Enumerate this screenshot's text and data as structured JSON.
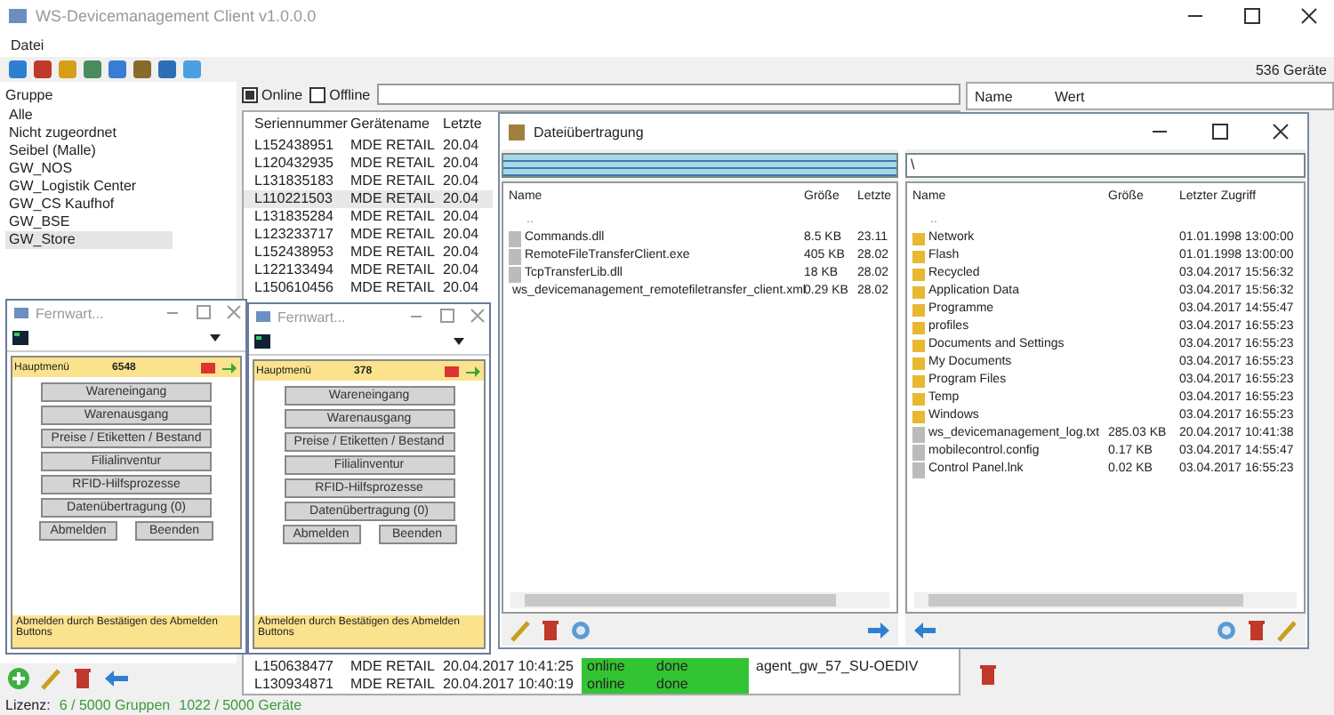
{
  "window": {
    "title": "WS-Devicemanagement Client v1.0.0.0"
  },
  "menu": [
    "Datei"
  ],
  "toolbar": {
    "device_count": "536 Geräte"
  },
  "groups": {
    "header": "Gruppe",
    "items": [
      {
        "label": "Alle",
        "selected": false
      },
      {
        "label": "Nicht zugeordnet",
        "selected": false
      },
      {
        "label": "Seibel (Malle)",
        "selected": false
      },
      {
        "label": "GW_NOS",
        "selected": false
      },
      {
        "label": "GW_Logistik Center",
        "selected": false
      },
      {
        "label": "GW_CS Kaufhof",
        "selected": false
      },
      {
        "label": "GW_BSE",
        "selected": false
      },
      {
        "label": "GW_Store",
        "selected": true
      }
    ]
  },
  "filter": {
    "online": {
      "label": "Online",
      "checked": true
    },
    "offline": {
      "label": "Offline",
      "checked": false
    }
  },
  "devices": {
    "columns": [
      "Seriennummer",
      "Gerätename",
      "Letzte"
    ],
    "rows": [
      {
        "serial": "L152438951",
        "name": "MDE RETAIL",
        "date": "20.04",
        "selected": false
      },
      {
        "serial": "L120432935",
        "name": "MDE RETAIL",
        "date": "20.04",
        "selected": false
      },
      {
        "serial": "L131835183",
        "name": "MDE RETAIL",
        "date": "20.04",
        "selected": false
      },
      {
        "serial": "L110221503",
        "name": "MDE RETAIL",
        "date": "20.04",
        "selected": true
      },
      {
        "serial": "L131835284",
        "name": "MDE RETAIL",
        "date": "20.04",
        "selected": false
      },
      {
        "serial": "L123233717",
        "name": "MDE RETAIL",
        "date": "20.04",
        "selected": false
      },
      {
        "serial": "L152438953",
        "name": "MDE RETAIL",
        "date": "20.04",
        "selected": false
      },
      {
        "serial": "L122133494",
        "name": "MDE RETAIL",
        "date": "20.04",
        "selected": false
      },
      {
        "serial": "L150610456",
        "name": "MDE RETAIL",
        "date": "20.04",
        "selected": false
      }
    ],
    "bottom_rows": [
      {
        "serial": "L150638477",
        "name": "MDE RETAIL",
        "date": "20.04.2017 10:41:25",
        "status": "online",
        "state": "done",
        "agent": "agent_gw_57_SU-OEDIV"
      },
      {
        "serial": "L130934871",
        "name": "MDE RETAIL",
        "date": "20.04.2017 10:40:19",
        "status": "online",
        "state": "done"
      }
    ]
  },
  "properties": {
    "columns": [
      "Name",
      "Wert"
    ]
  },
  "status_bar": {
    "label": "Lizenz:",
    "groups": "6 / 5000 Gruppen",
    "devices": "1022 / 5000 Geräte"
  },
  "remote_windows": [
    {
      "title": "Fernwart...",
      "menu_title": "Hauptmenü",
      "code": "6548",
      "buttons": [
        "Wareneingang",
        "Warenausgang",
        "Preise / Etiketten / Bestand",
        "Filialinventur",
        "RFID-Hilfsprozesse",
        "Datenübertragung (0)"
      ],
      "actions": [
        "Abmelden",
        "Beenden"
      ],
      "footer": "Abmelden durch Bestätigen des Abmelden Buttons"
    },
    {
      "title": "Fernwart...",
      "menu_title": "Hauptmenü",
      "code": "378",
      "buttons": [
        "Wareneingang",
        "Warenausgang",
        "Preise / Etiketten / Bestand",
        "Filialinventur",
        "RFID-Hilfsprozesse",
        "Datenübertragung (0)"
      ],
      "actions": [
        "Abmelden",
        "Beenden"
      ],
      "footer": "Abmelden durch Bestätigen des Abmelden Buttons"
    }
  ],
  "file_transfer": {
    "title": "Dateiübertragung",
    "local": {
      "path_selected": true,
      "columns": [
        "Name",
        "Größe",
        "Letzte"
      ],
      "files": [
        {
          "kind": "parent",
          "name": ".."
        },
        {
          "kind": "file",
          "name": "Commands.dll",
          "size": "8.5 KB",
          "date": "23.11"
        },
        {
          "kind": "file",
          "name": "RemoteFileTransferClient.exe",
          "size": "405 KB",
          "date": "28.02"
        },
        {
          "kind": "file",
          "name": "TcpTransferLib.dll",
          "size": "18 KB",
          "date": "28.02"
        },
        {
          "kind": "file",
          "name": "ws_devicemanagement_remotefiletransfer_client.xml",
          "size": "0.29 KB",
          "date": "28.02"
        }
      ]
    },
    "remote": {
      "path": "\\",
      "columns": [
        "Name",
        "Größe",
        "Letzter Zugriff"
      ],
      "files": [
        {
          "kind": "parent",
          "name": ".."
        },
        {
          "kind": "folder",
          "name": "Network",
          "date": "01.01.1998 13:00:00"
        },
        {
          "kind": "folder",
          "name": "Flash",
          "date": "01.01.1998 13:00:00"
        },
        {
          "kind": "folder",
          "name": "Recycled",
          "date": "03.04.2017 15:56:32"
        },
        {
          "kind": "folder",
          "name": "Application Data",
          "date": "03.04.2017 15:56:32"
        },
        {
          "kind": "folder",
          "name": "Programme",
          "date": "03.04.2017 14:55:47"
        },
        {
          "kind": "folder",
          "name": "profiles",
          "date": "03.04.2017 16:55:23"
        },
        {
          "kind": "folder",
          "name": "Documents and Settings",
          "date": "03.04.2017 16:55:23"
        },
        {
          "kind": "folder",
          "name": "My Documents",
          "date": "03.04.2017 16:55:23"
        },
        {
          "kind": "folder",
          "name": "Program Files",
          "date": "03.04.2017 16:55:23"
        },
        {
          "kind": "folder",
          "name": "Temp",
          "date": "03.04.2017 16:55:23"
        },
        {
          "kind": "folder",
          "name": "Windows",
          "date": "03.04.2017 16:55:23"
        },
        {
          "kind": "file",
          "name": "ws_devicemanagement_log.txt",
          "size": "285.03 KB",
          "date": "20.04.2017 10:41:38"
        },
        {
          "kind": "file",
          "name": "mobilecontrol.config",
          "size": "0.17 KB",
          "date": "03.04.2017 14:55:47"
        },
        {
          "kind": "file",
          "name": "Control Panel.lnk",
          "size": "0.02 KB",
          "date": "03.04.2017 16:55:23"
        }
      ]
    }
  }
}
